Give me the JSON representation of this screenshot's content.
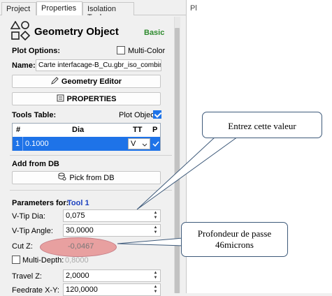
{
  "tabs": [
    {
      "label": "Project",
      "active": false
    },
    {
      "label": "Properties",
      "active": true
    },
    {
      "label": "Isolation Tool",
      "active": false
    }
  ],
  "right_panel_label": "Pl",
  "header": {
    "title": "Geometry Object",
    "mode": "Basic",
    "mode_color": "#2e8b2e",
    "icon": "shapes-icon"
  },
  "plot_options": {
    "label": "Plot Options:",
    "multicolor_label": "Multi-Color",
    "multicolor_checked": false
  },
  "name_field": {
    "label": "Name:",
    "value": "Carte interfacage-B_Cu.gbr_iso_combined"
  },
  "buttons": {
    "geometry_editor": "Geometry Editor",
    "properties": "PROPERTIES",
    "pick_from_db": "Pick from DB"
  },
  "tools_table": {
    "label": "Tools Table:",
    "plot_object_label": "Plot Object",
    "plot_object_checked": true,
    "columns": [
      "#",
      "Dia",
      "TT",
      "P"
    ],
    "rows": [
      {
        "num": "1",
        "dia": "0.1000",
        "tt": "V",
        "p_checked": true
      }
    ]
  },
  "add_from_db": {
    "label": "Add from DB"
  },
  "parameters": {
    "label": "Parameters for:",
    "tool": "Tool 1",
    "tool_color": "#1a3fbf",
    "vtip_dia": {
      "label": "V-Tip Dia:",
      "value": "0,075"
    },
    "vtip_angle": {
      "label": "V-Tip Angle:",
      "value": "30,0000"
    },
    "cut_z": {
      "label": "Cut Z:",
      "value": "-0,0467"
    },
    "multi_depth": {
      "label": "Multi-Depth:",
      "value": "0,8000",
      "checked": false
    },
    "travel_z": {
      "label": "Travel Z:",
      "value": "2,0000"
    },
    "feedrate_xy": {
      "label": "Feedrate X-Y:",
      "value": "120,0000"
    }
  },
  "callouts": {
    "enter_value": "Entrez cette valeur",
    "depth_line1": "Profondeur de passe",
    "depth_line2": "46microns"
  },
  "highlight_color": "#e8a0a0"
}
